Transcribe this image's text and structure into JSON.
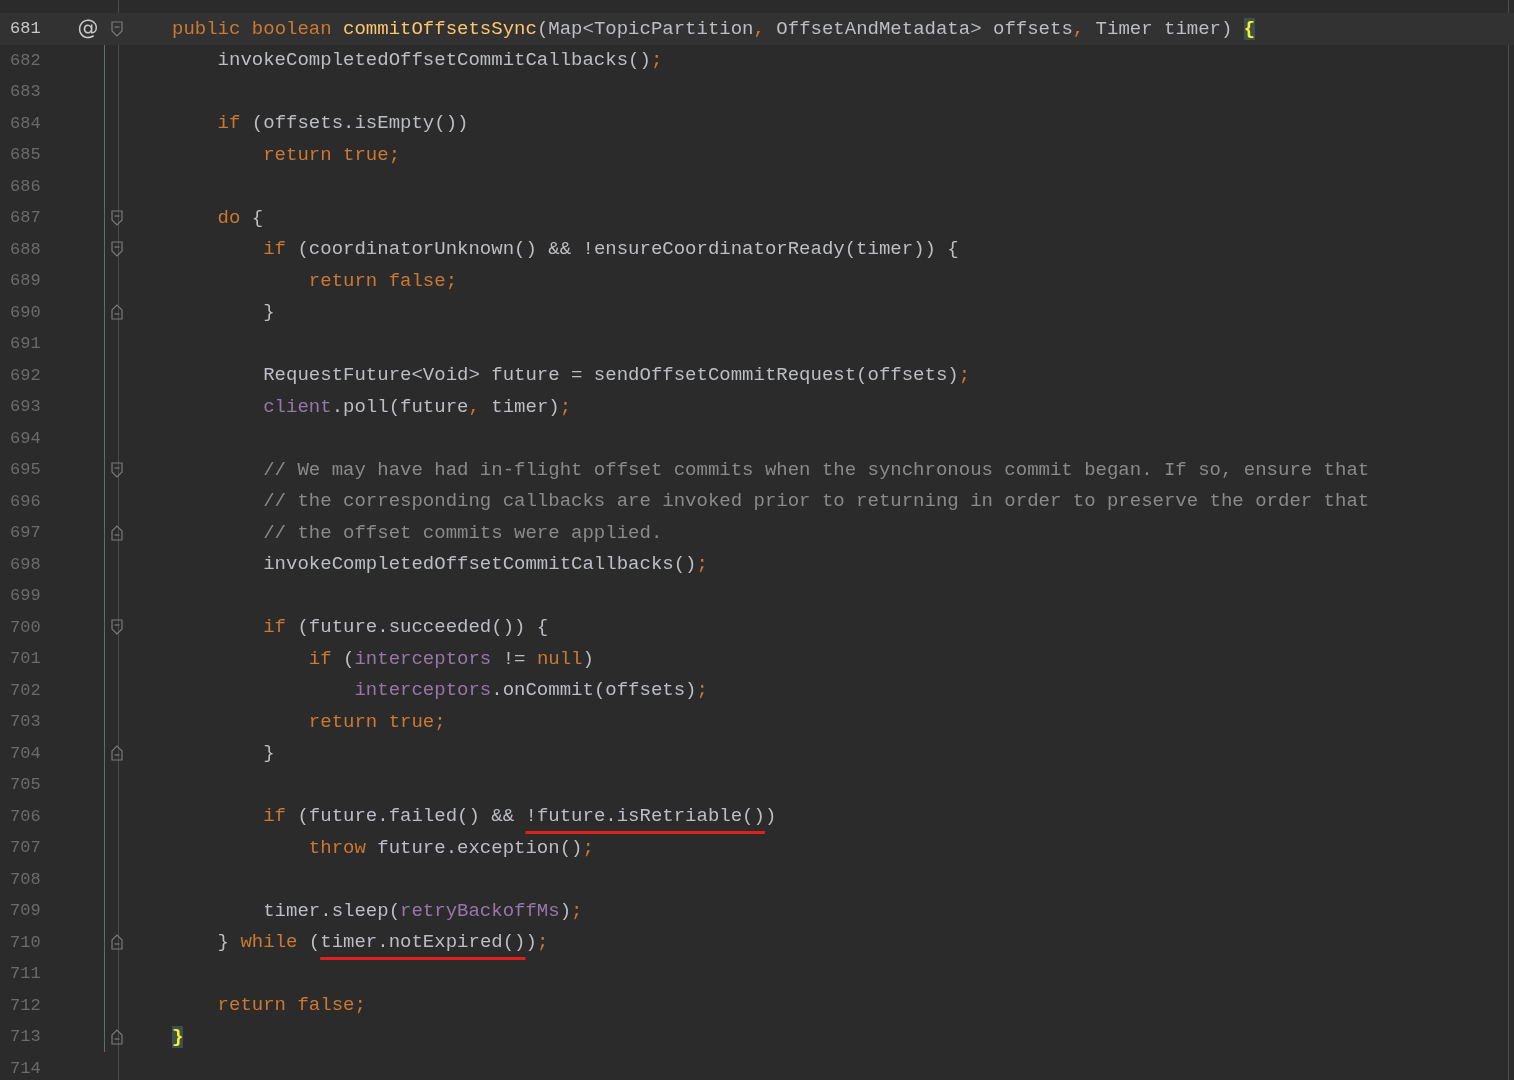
{
  "editor": {
    "lines": [
      {
        "number": "681",
        "current": true,
        "gutter_mark": "@",
        "fold_start": true,
        "tokens": [
          {
            "text": "public ",
            "kind": "keyword"
          },
          {
            "text": "boolean ",
            "kind": "keyword"
          },
          {
            "text": "commitOffsetsSync",
            "kind": "method"
          },
          {
            "text": "(Map<TopicPartition",
            "kind": "plain"
          },
          {
            "text": ",",
            "kind": "punct"
          },
          {
            "text": " OffsetAndMetadata> offsets",
            "kind": "plain"
          },
          {
            "text": ",",
            "kind": "punct"
          },
          {
            "text": " Timer timer) ",
            "kind": "plain"
          },
          {
            "text": "{",
            "kind": "brace"
          }
        ]
      },
      {
        "number": "682",
        "tokens": [
          {
            "text": "    invokeCompletedOffsetCommitCallbacks()",
            "kind": "plain"
          },
          {
            "text": ";",
            "kind": "punct"
          }
        ]
      },
      {
        "number": "683"
      },
      {
        "number": "684",
        "tokens": [
          {
            "text": "    if",
            "kind": "keyword"
          },
          {
            "text": " (offsets.isEmpty())",
            "kind": "plain"
          }
        ]
      },
      {
        "number": "685",
        "tokens": [
          {
            "text": "        return true;",
            "kind": "keyword"
          }
        ]
      },
      {
        "number": "686"
      },
      {
        "number": "687",
        "fold_start": true,
        "tokens": [
          {
            "text": "    do",
            "kind": "keyword"
          },
          {
            "text": " {",
            "kind": "plain"
          }
        ]
      },
      {
        "number": "688",
        "fold_start": true,
        "tokens": [
          {
            "text": "        if",
            "kind": "keyword"
          },
          {
            "text": " (coordinatorUnknown() && !ensureCoordinatorReady(timer)) {",
            "kind": "plain"
          }
        ]
      },
      {
        "number": "689",
        "tokens": [
          {
            "text": "            return false;",
            "kind": "keyword"
          }
        ]
      },
      {
        "number": "690",
        "fold_end": true,
        "tokens": [
          {
            "text": "        }",
            "kind": "plain"
          }
        ]
      },
      {
        "number": "691"
      },
      {
        "number": "692",
        "tokens": [
          {
            "text": "        RequestFuture<Void> future = sendOffsetCommitRequest(offsets)",
            "kind": "plain"
          },
          {
            "text": ";",
            "kind": "punct"
          }
        ]
      },
      {
        "number": "693",
        "tokens": [
          {
            "text": "        client",
            "kind": "field"
          },
          {
            "text": ".poll(future",
            "kind": "plain"
          },
          {
            "text": ",",
            "kind": "punct"
          },
          {
            "text": " timer)",
            "kind": "plain"
          },
          {
            "text": ";",
            "kind": "punct"
          }
        ]
      },
      {
        "number": "694"
      },
      {
        "number": "695",
        "fold_start": true,
        "tokens": [
          {
            "text": "        // We may have had in-flight offset commits when the synchronous commit began. If so, ensure that",
            "kind": "comment"
          }
        ]
      },
      {
        "number": "696",
        "tokens": [
          {
            "text": "        // the corresponding callbacks are invoked prior to returning in order to preserve the order that",
            "kind": "comment"
          }
        ]
      },
      {
        "number": "697",
        "fold_end": true,
        "tokens": [
          {
            "text": "        // the offset commits were applied.",
            "kind": "comment"
          }
        ]
      },
      {
        "number": "698",
        "tokens": [
          {
            "text": "        invokeCompletedOffsetCommitCallbacks()",
            "kind": "plain"
          },
          {
            "text": ";",
            "kind": "punct"
          }
        ]
      },
      {
        "number": "699"
      },
      {
        "number": "700",
        "fold_start": true,
        "tokens": [
          {
            "text": "        if",
            "kind": "keyword"
          },
          {
            "text": " (future.succeeded()) {",
            "kind": "plain"
          }
        ]
      },
      {
        "number": "701",
        "tokens": [
          {
            "text": "            if",
            "kind": "keyword"
          },
          {
            "text": " (",
            "kind": "plain"
          },
          {
            "text": "interceptors",
            "kind": "field"
          },
          {
            "text": " != ",
            "kind": "plain"
          },
          {
            "text": "null",
            "kind": "keyword"
          },
          {
            "text": ")",
            "kind": "plain"
          }
        ]
      },
      {
        "number": "702",
        "tokens": [
          {
            "text": "                interceptors",
            "kind": "field"
          },
          {
            "text": ".onCommit(offsets)",
            "kind": "plain"
          },
          {
            "text": ";",
            "kind": "punct"
          }
        ]
      },
      {
        "number": "703",
        "tokens": [
          {
            "text": "            return true;",
            "kind": "keyword"
          }
        ]
      },
      {
        "number": "704",
        "fold_end": true,
        "tokens": [
          {
            "text": "        }",
            "kind": "plain"
          }
        ]
      },
      {
        "number": "705"
      },
      {
        "number": "706",
        "tokens": [
          {
            "text": "        if",
            "kind": "keyword"
          },
          {
            "text": " (future.failed() && ",
            "kind": "plain"
          },
          {
            "text": "!future.isRetriable()",
            "kind": "plain",
            "underlined": true
          },
          {
            "text": ")",
            "kind": "plain"
          }
        ]
      },
      {
        "number": "707",
        "tokens": [
          {
            "text": "            throw",
            "kind": "keyword"
          },
          {
            "text": " future.exception()",
            "kind": "plain"
          },
          {
            "text": ";",
            "kind": "punct"
          }
        ]
      },
      {
        "number": "708"
      },
      {
        "number": "709",
        "tokens": [
          {
            "text": "        timer.sleep(",
            "kind": "plain"
          },
          {
            "text": "retryBackoffMs",
            "kind": "field"
          },
          {
            "text": ")",
            "kind": "plain"
          },
          {
            "text": ";",
            "kind": "punct"
          }
        ]
      },
      {
        "number": "710",
        "fold_end": true,
        "tokens": [
          {
            "text": "    } ",
            "kind": "plain"
          },
          {
            "text": "while",
            "kind": "keyword"
          },
          {
            "text": " (",
            "kind": "plain"
          },
          {
            "text": "timer.notExpired()",
            "kind": "plain",
            "underlined": true
          },
          {
            "text": ")",
            "kind": "plain"
          },
          {
            "text": ";",
            "kind": "punct"
          }
        ]
      },
      {
        "number": "711"
      },
      {
        "number": "712",
        "tokens": [
          {
            "text": "    return false;",
            "kind": "keyword"
          }
        ]
      },
      {
        "number": "713",
        "fold_end": true,
        "tokens": [
          {
            "text": "}",
            "kind": "brace"
          }
        ]
      },
      {
        "number": "714"
      }
    ]
  }
}
